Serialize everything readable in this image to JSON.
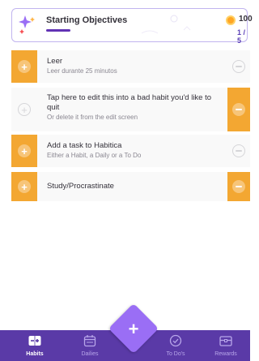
{
  "objectives": {
    "title": "Starting Objectives",
    "gold": "100",
    "progress": "1 / 5",
    "progress_fraction": 0.2
  },
  "habits": [
    {
      "title": "Leer",
      "notes": "Leer durante 25 minutos"
    },
    {
      "title": "Tap here to edit this into a bad habit you'd like to quit",
      "notes": "Or delete it from the edit screen"
    },
    {
      "title": "Add a task to Habitica",
      "notes": "Either a Habit, a Daily or a To Do"
    },
    {
      "title": "Study/Procrastinate",
      "notes": ""
    }
  ],
  "nav": {
    "habits": "Habits",
    "dailies": "Dailies",
    "todos": "To Do's",
    "rewards": "Rewards"
  },
  "icons": {
    "star": "sparkle-star-icon",
    "gold": "gold-coin-icon",
    "plus": "plus-icon",
    "minus": "minus-icon",
    "habits": "habits-icon",
    "dailies": "calendar-icon",
    "todos": "checkmark-circle-icon",
    "rewards": "treasure-chest-icon"
  },
  "colors": {
    "accent_purple": "#5a3aa7",
    "fab_purple": "#9a6ef5",
    "habit_orange": "#f3a732",
    "gold": "#ffa624"
  }
}
